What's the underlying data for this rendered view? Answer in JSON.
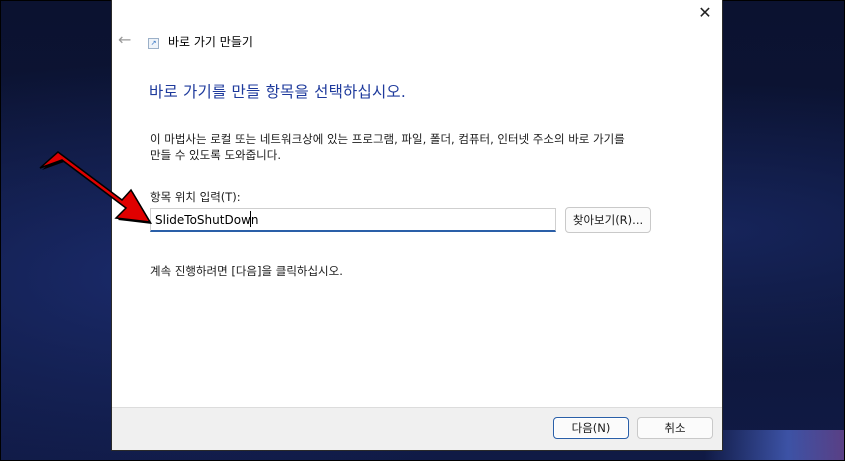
{
  "window": {
    "title": "바로 가기 만들기",
    "close_icon": "close-icon",
    "back_icon": "back-arrow-icon"
  },
  "main": {
    "heading": "바로 가기를 만들 항목을 선택하십시오.",
    "description_line1": "이 마법사는 로컬 또는 네트워크상에 있는 프로그램, 파일, 폴더, 컴퓨터, 인터넷 주소의 바로 가기를",
    "description_line2": "만들 수 있도록 도와줍니다.",
    "field_label": "항목 위치 입력(T):",
    "location_value": "SlideToShutDown",
    "browse_label": "찾아보기(R)...",
    "continue_text": "계속 진행하려면 [다음]을 클릭하십시오."
  },
  "footer": {
    "next_label": "다음(N)",
    "cancel_label": "취소"
  },
  "colors": {
    "heading": "#1e3a9c",
    "accent": "#2a5fa8",
    "annotation_arrow": "#e00000"
  }
}
